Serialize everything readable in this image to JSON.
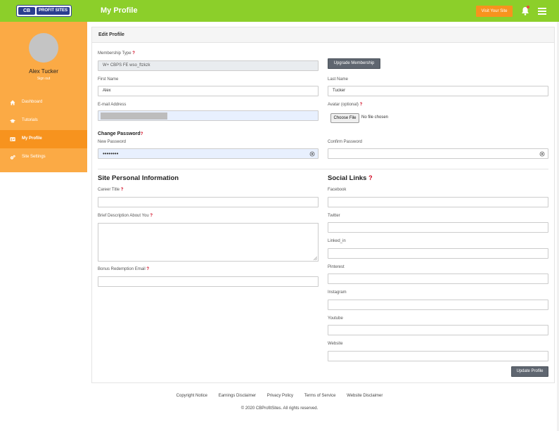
{
  "brand": {
    "logo_mark": "CB",
    "logo_text": "PROFIT SITES"
  },
  "header": {
    "title": "My Profile",
    "visit_site_label": "Visit Your Site"
  },
  "sidebar": {
    "user_name": "Alex Tucker",
    "sign_out": "Sign out",
    "items": [
      {
        "label": "Dashboard",
        "icon": "home-icon",
        "active": false
      },
      {
        "label": "Tutorials",
        "icon": "graduation-cap-icon",
        "active": false
      },
      {
        "label": "My Profile",
        "icon": "id-card-icon",
        "active": true
      },
      {
        "label": "Site Settings",
        "icon": "cogs-icon",
        "active": false
      }
    ]
  },
  "form": {
    "card_title": "Edit Profile",
    "membership_type_label": "Membership Type",
    "membership_type_value": "W+ CBPS FE wso_ftzkzk",
    "upgrade_label": "Upgrade Membership",
    "first_name_label": "First Name",
    "first_name_value": "Alex",
    "last_name_label": "Last Name",
    "last_name_value": "Tucker",
    "email_label": "E-mail Address",
    "avatar_label": "Avatar (optional)",
    "choose_file_label": "Choose File",
    "no_file_text": "No file chosen",
    "change_password_title": "Change Password",
    "new_password_label": "New Password",
    "new_password_value": "••••••••",
    "confirm_password_label": "Confirm Password",
    "confirm_password_value": "",
    "site_info_title": "Site Personal Information",
    "career_title_label": "Career Title",
    "career_title_value": "",
    "brief_desc_label": "Brief Description About You",
    "bonus_email_label": "Bonus Redemption Email",
    "bonus_email_value": "",
    "social_title": "Social Links",
    "social": [
      {
        "label": "Facebook",
        "value": ""
      },
      {
        "label": "Twitter",
        "value": ""
      },
      {
        "label": "Linked_in",
        "value": ""
      },
      {
        "label": "Pinterest",
        "value": ""
      },
      {
        "label": "Instagram",
        "value": ""
      },
      {
        "label": "Youtube",
        "value": ""
      },
      {
        "label": "Website",
        "value": ""
      }
    ],
    "update_label": "Update Profile",
    "help_mark": "?"
  },
  "footer": {
    "links": [
      "Copyright Notice",
      "Earnings Disclaimer",
      "Privacy Policy",
      "Terms of Service",
      "Website Disclaimer"
    ],
    "copyright": "© 2020 CBProfitSites. All rights reserved."
  },
  "colors": {
    "topbar": "#8ccf2a",
    "sidebar": "#fbaa45",
    "sidebar_active": "#f7931e",
    "accent_button": "#f7931e",
    "help_mark": "#d0021b"
  }
}
